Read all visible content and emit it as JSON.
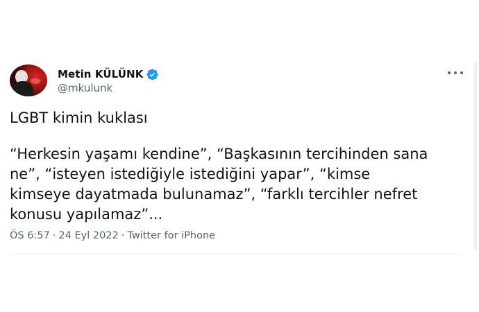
{
  "author": {
    "display_name": "Metin KÜLÜNK",
    "handle": "@mkulunk",
    "verified_icon": "verified-badge-icon",
    "avatar_icon": "profile-photo"
  },
  "more_icon": "more-options-icon",
  "tweet": {
    "headline": "LGBT kimin kuklası",
    "body": "“Herkesin yaşamı kendine”, “Başkasının tercihinden sana\nne”, “isteyen istediğiyle istediğini yapar”, “kimse\nkimseye dayatmada bulunamaz”, “farklı tercihler nefret\nkonusu yapılamaz”..."
  },
  "meta": {
    "time": "ÖS 6:57",
    "separator": "·",
    "date": "24 Eyl 2022",
    "source": "Twitter for iPhone"
  },
  "colors": {
    "text": "#0f1419",
    "secondary": "#536471",
    "verified_blue": "#1d9bf0"
  }
}
